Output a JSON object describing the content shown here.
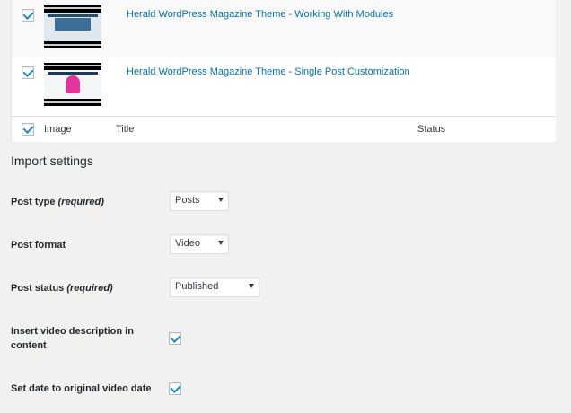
{
  "items": [
    {
      "title": "Herald WordPress Magazine Theme - Working With Modules",
      "checked": true
    },
    {
      "title": "Herald WordPress Magazine Theme - Single Post Customization",
      "checked": true
    }
  ],
  "columns": {
    "image": "Image",
    "title": "Title",
    "status": "Status"
  },
  "settings": {
    "heading": "Import settings",
    "post_type": {
      "label": "Post type",
      "hint": "(required)",
      "value": "Posts"
    },
    "post_format": {
      "label": "Post format",
      "value": "Video"
    },
    "post_status": {
      "label": "Post status",
      "hint": "(required)",
      "value": "Published"
    },
    "insert_description": {
      "label": "Insert video description in content",
      "checked": true
    },
    "set_date": {
      "label": "Set date to original video date",
      "checked": true
    }
  },
  "colors": {
    "link": "#0073aa",
    "check": "#1e8cbe",
    "background": "#f1f1f1"
  }
}
